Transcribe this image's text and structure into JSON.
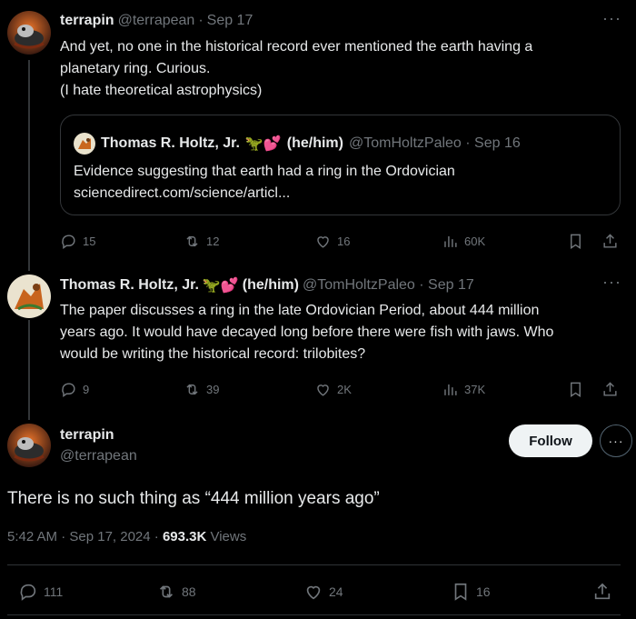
{
  "tweet1": {
    "name": "terrapin",
    "handle": "@terrapean",
    "dot": "·",
    "date": "Sep 17",
    "more": "···",
    "text_lines": [
      "And yet, no one in the historical record ever mentioned the earth having a",
      "planetary ring. Curious.",
      "(I hate theoretical astrophysics)"
    ],
    "quote": {
      "name": "Thomas R. Holtz, Jr.",
      "emoji": "🦖💕",
      "pronouns": "(he/him)",
      "handle_date": "@TomHoltzPaleo · Sep 16",
      "text_lines": [
        "Evidence suggesting that earth had a ring in the Ordovician",
        "sciencedirect.com/science/articl..."
      ]
    },
    "actions": {
      "replies": "15",
      "reposts": "12",
      "likes": "16",
      "views": "60K"
    }
  },
  "tweet2": {
    "name": "Thomas R. Holtz, Jr.",
    "emoji": "🦖💕",
    "pronouns": "(he/him)",
    "handle_date": "@TomHoltzPaleo · Sep 17",
    "more": "···",
    "text_lines": [
      "The paper discusses a ring in the late Ordovician Period, about 444 million",
      "years ago. It would have decayed long before there were fish with jaws. Who",
      "would be writing the historical record: trilobites?"
    ],
    "actions": {
      "replies": "9",
      "reposts": "39",
      "likes": "2K",
      "views": "37K"
    }
  },
  "tweet3": {
    "name": "terrapin",
    "handle": "@terrapean",
    "follow_label": "Follow",
    "more": "···",
    "text": "There is no such thing as “444 million years ago”",
    "time": "5:42 AM · Sep 17, 2024 · ",
    "views_count": "693.3K",
    "views_label": " Views",
    "actions": {
      "replies": "111",
      "reposts": "88",
      "likes": "24",
      "bookmarks": "16"
    }
  },
  "colors": {
    "background": "#000000",
    "text": "#e7e9ea",
    "muted": "#71767b",
    "border": "#333639",
    "follow_bg": "#eff3f4"
  }
}
